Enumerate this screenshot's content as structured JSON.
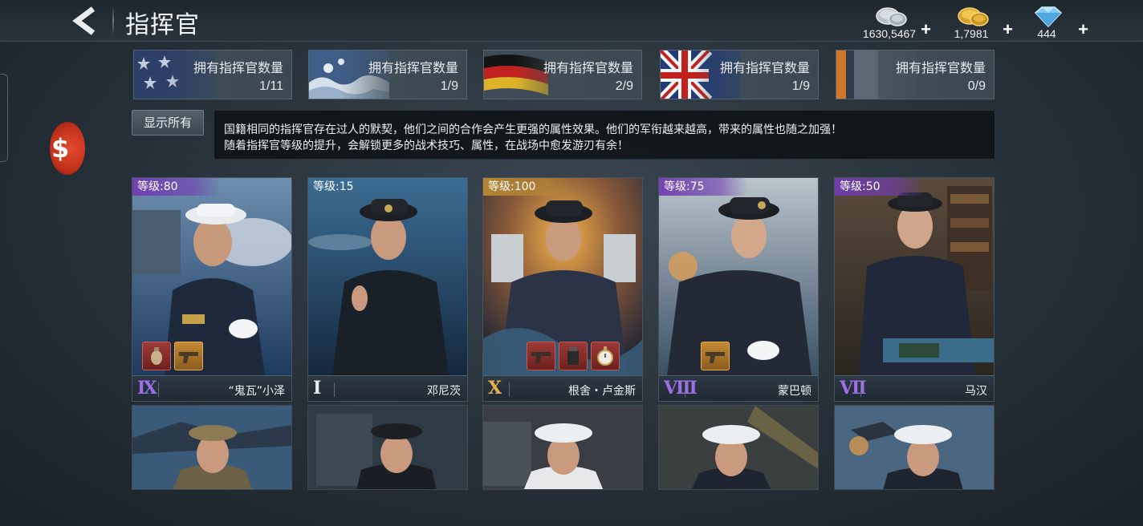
{
  "header": {
    "title": "指挥官",
    "currencies": [
      {
        "icon": "silver-coins-icon",
        "value": "1630,5467"
      },
      {
        "icon": "gold-coins-icon",
        "value": "1,7981"
      },
      {
        "icon": "diamond-icon",
        "value": "444"
      }
    ],
    "plus_label": "+"
  },
  "side": {
    "emblem_label": "$"
  },
  "nations": [
    {
      "flag": "usa-flag-icon",
      "label": "拥有指挥官数量",
      "count": "1/11"
    },
    {
      "flag": "japan-flag-icon",
      "label": "拥有指挥官数量",
      "count": "1/9"
    },
    {
      "flag": "germany-flag-icon",
      "label": "拥有指挥官数量",
      "count": "2/9"
    },
    {
      "flag": "uk-flag-icon",
      "label": "拥有指挥官数量",
      "count": "1/9"
    },
    {
      "flag": "other-flag-icon",
      "label": "拥有指挥官数量",
      "count": "0/9"
    }
  ],
  "show_all_label": "显示所有",
  "info": {
    "line1": "国籍相同的指挥官存在过人的默契，他们之间的合作会产生更强的属性效果。他们的军衔越来越高，带来的属性也随之加强！",
    "line2": "随着指挥官等级的提升，会解锁更多的战术技巧、属性，在战场中愈发游刃有余！"
  },
  "commanders": [
    {
      "level": "等级:80",
      "rank": "Ⅸ",
      "name": "“鬼瓦”小泽",
      "level_color": "purple",
      "rank_color": "purple",
      "equipment": [
        "red",
        "gold"
      ]
    },
    {
      "level": "等级:15",
      "rank": "Ⅰ",
      "name": "邓尼茨",
      "level_color": "none",
      "rank_color": "white",
      "equipment": []
    },
    {
      "level": "等级:100",
      "rank": "Ⅹ",
      "name": "根舍・卢金斯",
      "level_color": "gold",
      "rank_color": "gold",
      "equipment": [
        "red",
        "red",
        "red"
      ]
    },
    {
      "level": "等级:75",
      "rank": "Ⅷ",
      "name": "蒙巴顿",
      "level_color": "purple",
      "rank_color": "purple",
      "equipment": [
        "gold"
      ]
    },
    {
      "level": "等级:50",
      "rank": "Ⅶ",
      "name": "马汉",
      "level_color": "purple",
      "rank_color": "purple",
      "equipment": []
    }
  ],
  "colors": {
    "purple": "#703cb0",
    "gold": "#ba8a34",
    "equip_red": "#9c3a36",
    "equip_gold": "#c48a34"
  }
}
